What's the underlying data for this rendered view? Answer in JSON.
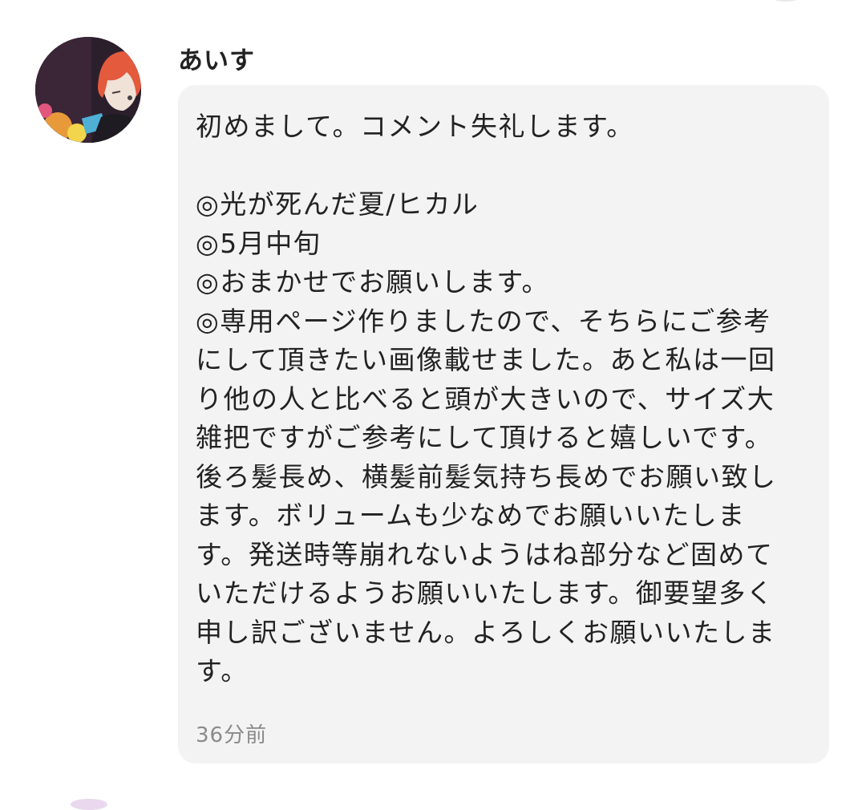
{
  "comment": {
    "username": "あいす",
    "avatar_icon": "user-avatar-icon",
    "message_lines": [
      "初めまして。コメント失礼します。",
      "",
      "◎光が死んだ夏/ヒカル",
      "◎5月中旬",
      "◎おまかせでお願いします。",
      "◎専用ページ作りましたので、そちらにご参考",
      "にして頂きたい画像載せました。あと私は一回",
      "り他の人と比べると頭が大きいので、サイズ大",
      "雑把ですがご参考にして頂けると嬉しいです。",
      "後ろ髪長め、横髪前髪気持ち長めでお願い致し",
      "ます。ボリュームも少なめでお願いいたしま",
      "す。発送時等崩れないようはね部分など固めて",
      "いただけるようお願いいたします。御要望多く",
      "申し訳ございません。よろしくお願いいたしま",
      "す。"
    ],
    "timestamp": "36分前",
    "bubble_color": "#f3f3f3"
  }
}
